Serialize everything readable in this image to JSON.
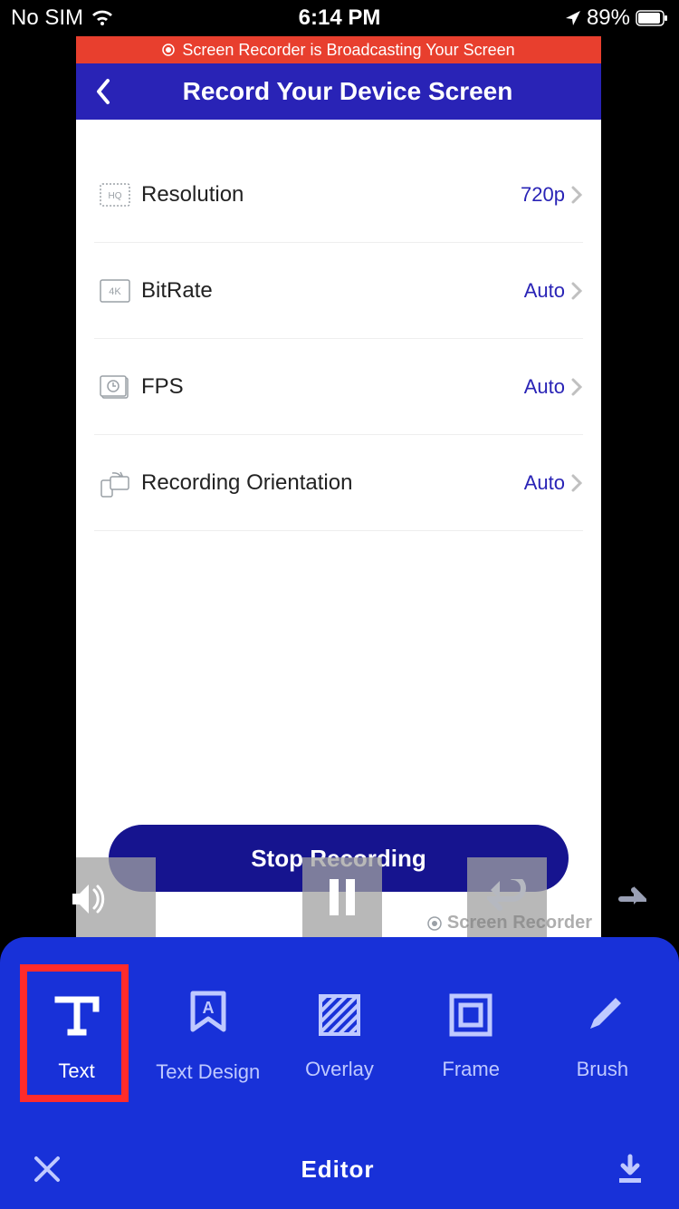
{
  "status": {
    "carrier": "No SIM",
    "time": "6:14 PM",
    "battery": "89%"
  },
  "inner": {
    "broadcast": "Screen Recorder is Broadcasting Your Screen",
    "title": "Record Your Device Screen",
    "rows": [
      {
        "label": "Resolution",
        "value": "720p"
      },
      {
        "label": "BitRate",
        "value": "Auto"
      },
      {
        "label": "FPS",
        "value": "Auto"
      },
      {
        "label": "Recording Orientation",
        "value": "Auto"
      }
    ],
    "stop": "Stop Recording",
    "watermark": "Screen Recorder"
  },
  "editor": {
    "tools": [
      {
        "label": "Text"
      },
      {
        "label": "Text Design"
      },
      {
        "label": "Overlay"
      },
      {
        "label": "Frame"
      },
      {
        "label": "Brush"
      }
    ],
    "title": "Editor"
  }
}
